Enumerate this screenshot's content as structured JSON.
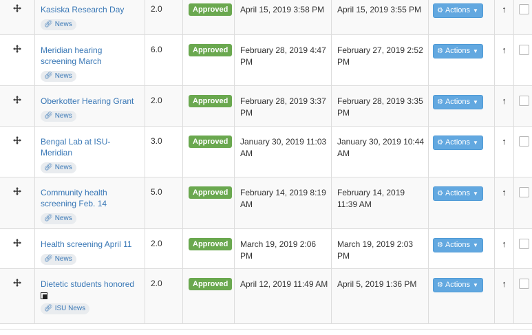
{
  "status_label": "Approved",
  "actions_label": "Actions",
  "rows": [
    {
      "title": "Kasiska Research Day",
      "weight": "2.0",
      "updated": "April 15, 2019 3:58 PM",
      "created": "April 15, 2019 3:55 PM",
      "tag": "News",
      "external": false
    },
    {
      "title": "Meridian hearing screening March",
      "weight": "6.0",
      "updated": "February 28, 2019 4:47 PM",
      "created": "February 27, 2019 2:52 PM",
      "tag": "News",
      "external": false
    },
    {
      "title": "Oberkotter Hearing Grant",
      "weight": "2.0",
      "updated": "February 28, 2019 3:37 PM",
      "created": "February 28, 2019 3:35 PM",
      "tag": "News",
      "external": false
    },
    {
      "title": "Bengal Lab at ISU-Meridian",
      "weight": "3.0",
      "updated": "January 30, 2019 11:03 AM",
      "created": "January 30, 2019 10:44 AM",
      "tag": "News",
      "external": false
    },
    {
      "title": "Community health screening Feb. 14",
      "weight": "5.0",
      "updated": "February 14, 2019 8:19 AM",
      "created": "February 14, 2019 11:39 AM",
      "tag": "News",
      "external": false
    },
    {
      "title": "Health screening April 11",
      "weight": "2.0",
      "updated": "March 19, 2019 2:06 PM",
      "created": "March 19, 2019 2:03 PM",
      "tag": "News",
      "external": false
    },
    {
      "title": "Dietetic students honored",
      "weight": "2.0",
      "updated": "April 12, 2019 11:49 AM",
      "created": "April 5, 2019 1:36 PM",
      "tag": "ISU News",
      "external": true
    }
  ]
}
